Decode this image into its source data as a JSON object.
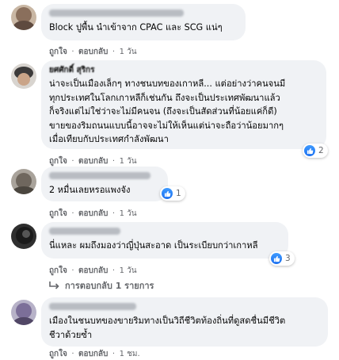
{
  "actions": {
    "like": "ถูกใจ",
    "reply": "ตอบกลับ",
    "separator": "·"
  },
  "comments": [
    {
      "text": "Block ปูพื้น นำเข้าจาก CPAC และ SCG แน่ๆ",
      "time": "1 วัน",
      "reactions": ""
    },
    {
      "name": "ยศศักดิ์ สุริกร",
      "text": "น่าจะเป็นเมืองเล็กๆ ทางชนบทของเกาหลี... แต่อย่างว่าคนจนมี\nทุกประเทศในโลกเกาหลีก็เช่นกัน ถึงจะเป็นประเทศพัฒนาแล้ว\nก็จริงแต่ไม่ใช่ว่าจะไม่มีคนจน (ถึงจะเป็นสัดส่วนที่น้อยแค่ก็ดี)\nขายของริมถนนแบบนี้อาจจะไม่ให้เห็นแต่น่าจะถือว่าน้อยมากๆ\nเมื่อเทียบกับประเทศกำลังพัฒนา",
      "time": "1 วัน",
      "reactions": "2"
    },
    {
      "text": "2 หมื่นเลยหรอแพงจัง",
      "time": "1 วัน",
      "reactions": "1"
    },
    {
      "text": "นี่แหละ ผมถึงมองว่าญี่ปุ่นสะอาด เป็นระเบียบกว่าเกาหลี",
      "time": "1 วัน",
      "reactions": "3"
    },
    {
      "text": "เมืองในชนบทของขายริมทางเป็นวิถีชีวิตท้องถิ่นที่ดูสดชื่นมีชีวิต\nชีวาด้วยซ้ำ",
      "time": "1 ชม.",
      "reactions": ""
    }
  ],
  "replies_link": "การตอบกลับ 1 รายการ",
  "colors": {
    "bubble": "#f0f2f5",
    "meta": "#65676b",
    "like": "#1877f2"
  }
}
